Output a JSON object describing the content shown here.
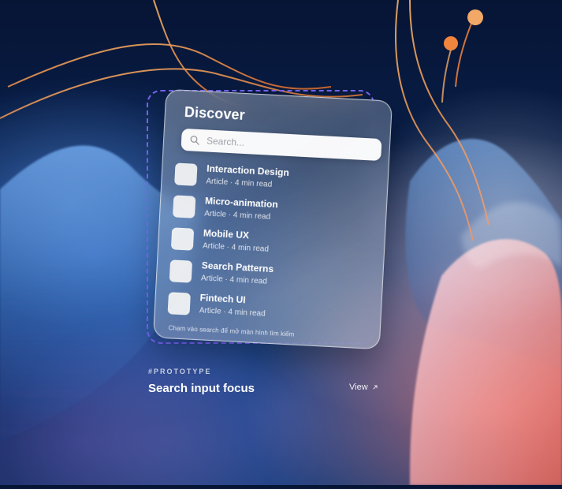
{
  "colors": {
    "dash_outline": "#7f67ff",
    "background": "#0b1a3d"
  },
  "card": {
    "title": "Discover",
    "search": {
      "placeholder": "Search..."
    },
    "items": [
      {
        "title": "Interaction Design",
        "subtitle": "Article · 4 min read"
      },
      {
        "title": "Micro-animation",
        "subtitle": "Article · 4 min read"
      },
      {
        "title": "Mobile UX",
        "subtitle": "Article · 4 min read"
      },
      {
        "title": "Search Patterns",
        "subtitle": "Article · 4 min read"
      },
      {
        "title": "Fintech UI",
        "subtitle": "Article · 4 min read"
      }
    ],
    "hint": "Chạm vào search để mở màn hình tìm kiếm"
  },
  "footer": {
    "tag": "#PROTOTYPE",
    "title": "Search input focus",
    "view_label": "View"
  },
  "icons": {
    "search": "search-icon",
    "view": "arrow-up-right-icon"
  }
}
